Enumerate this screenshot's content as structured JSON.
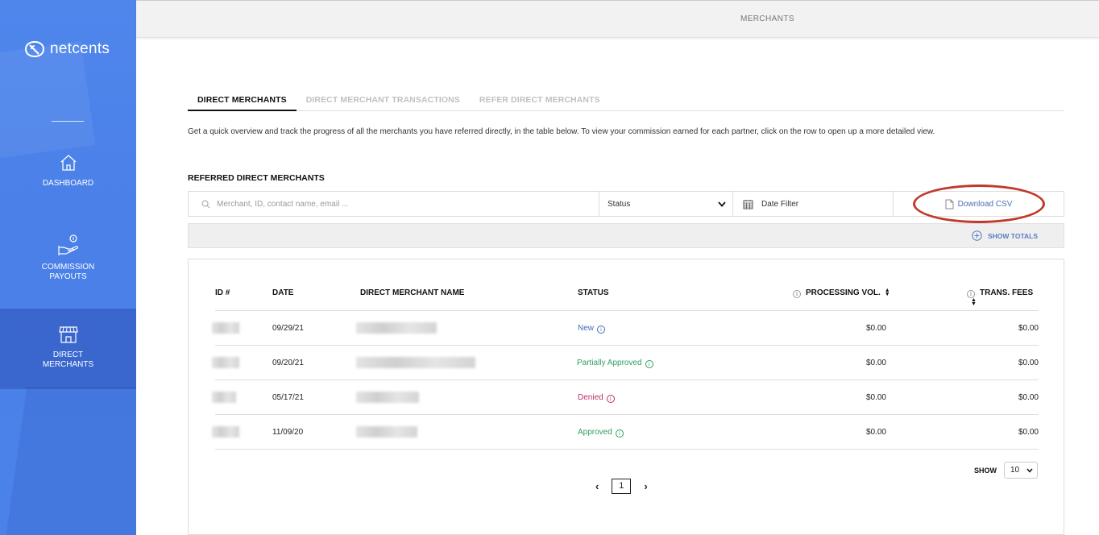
{
  "brand": {
    "name": "netcents",
    "logo_icon": "netcents-logo-icon"
  },
  "sidebar": {
    "items": [
      {
        "label": "DASHBOARD",
        "icon": "home-icon",
        "active": false
      },
      {
        "label": "COMMISSION PAYOUTS",
        "icon": "hand-coin-icon",
        "active": false
      },
      {
        "label": "DIRECT MERCHANTS",
        "icon": "storefront-icon",
        "active": true
      }
    ]
  },
  "topbar": {
    "title": "MERCHANTS"
  },
  "tabs": [
    {
      "label": "DIRECT MERCHANTS",
      "active": true
    },
    {
      "label": "DIRECT MERCHANT TRANSACTIONS",
      "active": false
    },
    {
      "label": "REFER DIRECT MERCHANTS",
      "active": false
    }
  ],
  "description": "Get a quick overview and track the progress of all the merchants you have referred directly, in the table below. To view your commission earned for each partner, click on the row to open up a more detailed view.",
  "section_title": "REFERRED DIRECT MERCHANTS",
  "filters": {
    "search_placeholder": "Merchant, ID, contact name, email ...",
    "status_label": "Status",
    "date_filter_label": "Date Filter",
    "download_label": "Download CSV",
    "highlight_color": "#c0392b"
  },
  "totals": {
    "label": "SHOW TOTALS"
  },
  "table": {
    "columns": [
      "ID #",
      "DATE",
      "DIRECT MERCHANT NAME",
      "STATUS",
      "PROCESSING VOL.",
      "TRANS. FEES"
    ],
    "rows": [
      {
        "id": "",
        "date": "09/29/21",
        "name": "",
        "status": "New",
        "status_class": "st-new",
        "processing_vol": "$0.00",
        "trans_fees": "$0.00"
      },
      {
        "id": "",
        "date": "09/20/21",
        "name": "",
        "status": "Partially Approved",
        "status_class": "st-partial",
        "processing_vol": "$0.00",
        "trans_fees": "$0.00"
      },
      {
        "id": "",
        "date": "05/17/21",
        "name": "",
        "status": "Denied",
        "status_class": "st-denied",
        "processing_vol": "$0.00",
        "trans_fees": "$0.00"
      },
      {
        "id": "",
        "date": "11/09/20",
        "name": "",
        "status": "Approved",
        "status_class": "st-approved",
        "processing_vol": "$0.00",
        "trans_fees": "$0.00"
      }
    ]
  },
  "pagination": {
    "prev": "‹",
    "current_page": "1",
    "next": "›",
    "show_label": "SHOW",
    "page_size": "10"
  },
  "colors": {
    "sidebar": "#4a80e8",
    "new": "#3f6fb8",
    "approved": "#2e9e63",
    "denied": "#c0306b",
    "link": "#4b6fb8"
  }
}
